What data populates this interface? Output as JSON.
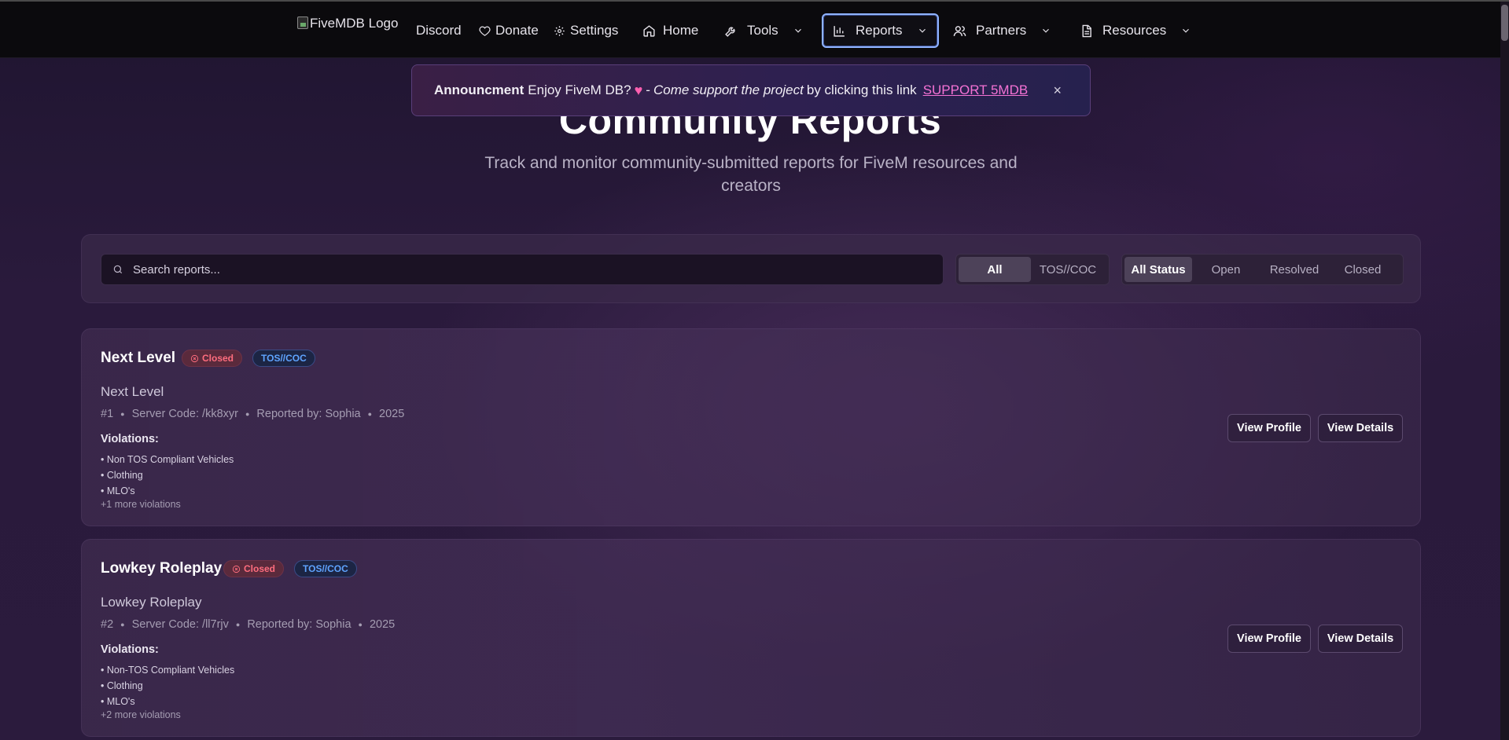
{
  "nav": {
    "logo_alt": "FiveMDB Logo",
    "items": [
      {
        "label": "Discord"
      },
      {
        "label": "Donate"
      },
      {
        "label": "Settings"
      },
      {
        "label": "Home"
      },
      {
        "label": "Tools"
      },
      {
        "label": "Reports"
      },
      {
        "label": "Partners"
      },
      {
        "label": "Resources"
      }
    ]
  },
  "announcement": {
    "label": "Announcment",
    "text1": "Enjoy FiveM DB?",
    "heart": "♥",
    "dash": "-",
    "italic": "Come support the project",
    "text2": "by clicking this link",
    "link": "SUPPORT 5MDB",
    "close": "×"
  },
  "header": {
    "title": "Community Reports",
    "subtitle": "Track and monitor community-submitted reports for FiveM resources and creators"
  },
  "filters": {
    "search_placeholder": "Search reports...",
    "type_options": [
      "All",
      "TOS//COC"
    ],
    "status_options": [
      "All Status",
      "Open",
      "Resolved",
      "Closed"
    ]
  },
  "reports": [
    {
      "title": "Next Level",
      "status": "Closed",
      "category": "TOS//COC",
      "subtitle": "Next Level",
      "id": "#1",
      "server_code": "Server Code: /kk8xyr",
      "reported_by": "Reported by: Sophia",
      "year": "2025",
      "violations_label": "Violations:",
      "violations": [
        "• Non TOS Compliant Vehicles",
        "• Clothing",
        "• MLO's"
      ],
      "more": "+1 more violations",
      "view_profile": "View Profile",
      "view_details": "View Details"
    },
    {
      "title": "Lowkey Roleplay",
      "status": "Closed",
      "category": "TOS//COC",
      "subtitle": "Lowkey Roleplay",
      "id": "#2",
      "server_code": "Server Code: /ll7rjv",
      "reported_by": "Reported by: Sophia",
      "year": "2025",
      "violations_label": "Violations:",
      "violations": [
        "• Non-TOS Compliant Vehicles",
        "• Clothing",
        "• MLO's"
      ],
      "more": "+2 more violations",
      "view_profile": "View Profile",
      "view_details": "View Details"
    }
  ],
  "colors": {
    "accent_link": "#f472d4",
    "closed_badge": "#ff6d7e",
    "tos_badge": "#5fa4ff",
    "focus_ring": "#8fb3ff"
  }
}
